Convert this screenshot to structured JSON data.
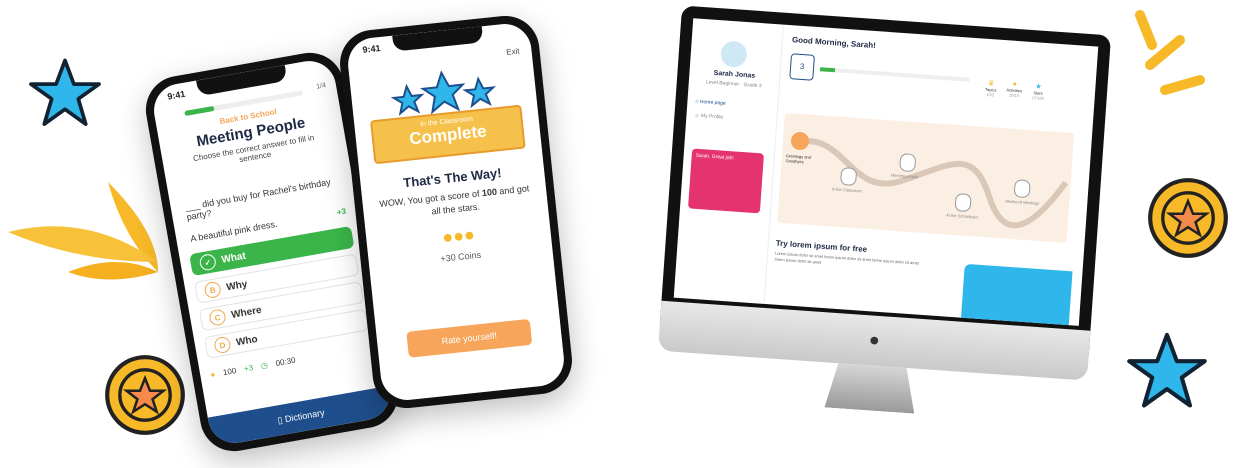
{
  "phone1": {
    "time": "9:41",
    "progress": "1/4",
    "progress_fraction": 0.25,
    "category": "Back to School",
    "title": "Meeting People",
    "instruction": "Choose the correct answer to fill in sentence",
    "question": "___ did you buy for Rachel's birthday party?",
    "hint": "A beautiful pink dress.",
    "coin_bonus": "+3",
    "options": [
      {
        "letter": "✓",
        "text": "What",
        "selected": true
      },
      {
        "letter": "B",
        "text": "Why",
        "selected": false
      },
      {
        "letter": "C",
        "text": "Where",
        "selected": false
      },
      {
        "letter": "D",
        "text": "Who",
        "selected": false
      }
    ],
    "footer": {
      "coins": "100",
      "coin_delta": "+3",
      "timer": "00:30"
    },
    "dictionary_label": "Dictionary"
  },
  "phone2": {
    "time": "9:41",
    "exit_label": "Exit",
    "ribbon_small": "In the Classroom",
    "ribbon_big": "Complete",
    "headline": "That's The Way!",
    "message_part1": "WOW, You got a score of ",
    "score": "100",
    "message_part2": " and got all the stars.",
    "coins_earned": "+30 Coins",
    "rate_button": "Rate yourself!"
  },
  "desktop": {
    "greeting": "Good Morning, Sarah!",
    "user_name": "Sarah Jonas",
    "user_level": "Level Beginner · Grade 3",
    "nav_home": "Home page",
    "nav_profile": "My Profile",
    "level_badge": "3",
    "stats": [
      {
        "label": "Topics",
        "value": "10/2"
      },
      {
        "label": "Activities",
        "value": "10/19"
      },
      {
        "label": "Stars",
        "value": "17/100"
      }
    ],
    "promo_title": "Sarah, Great job!",
    "map_lessons": [
      "Greetings and Goodbyes",
      "In the Classroom",
      "Meeting people",
      "At the Schoolyard",
      "Weekend Meetings"
    ],
    "banner_title": "Try lorem ipsum for free",
    "banner_text": "Lorem ipsum dolor sit amet lorem ipsum dolor sit amet lorem ipsum dolor sit amet lorem ipsum dolor sit amet"
  },
  "colors": {
    "brand_orange": "#f6a55a",
    "green": "#3bb54a",
    "navy": "#1f4e8c",
    "pink": "#e5336f",
    "gold": "#f7b928",
    "star_blue": "#2fb6ea"
  },
  "decorations": [
    "star-icon",
    "coin-icon",
    "leaf-icon",
    "sparkle-icon"
  ]
}
